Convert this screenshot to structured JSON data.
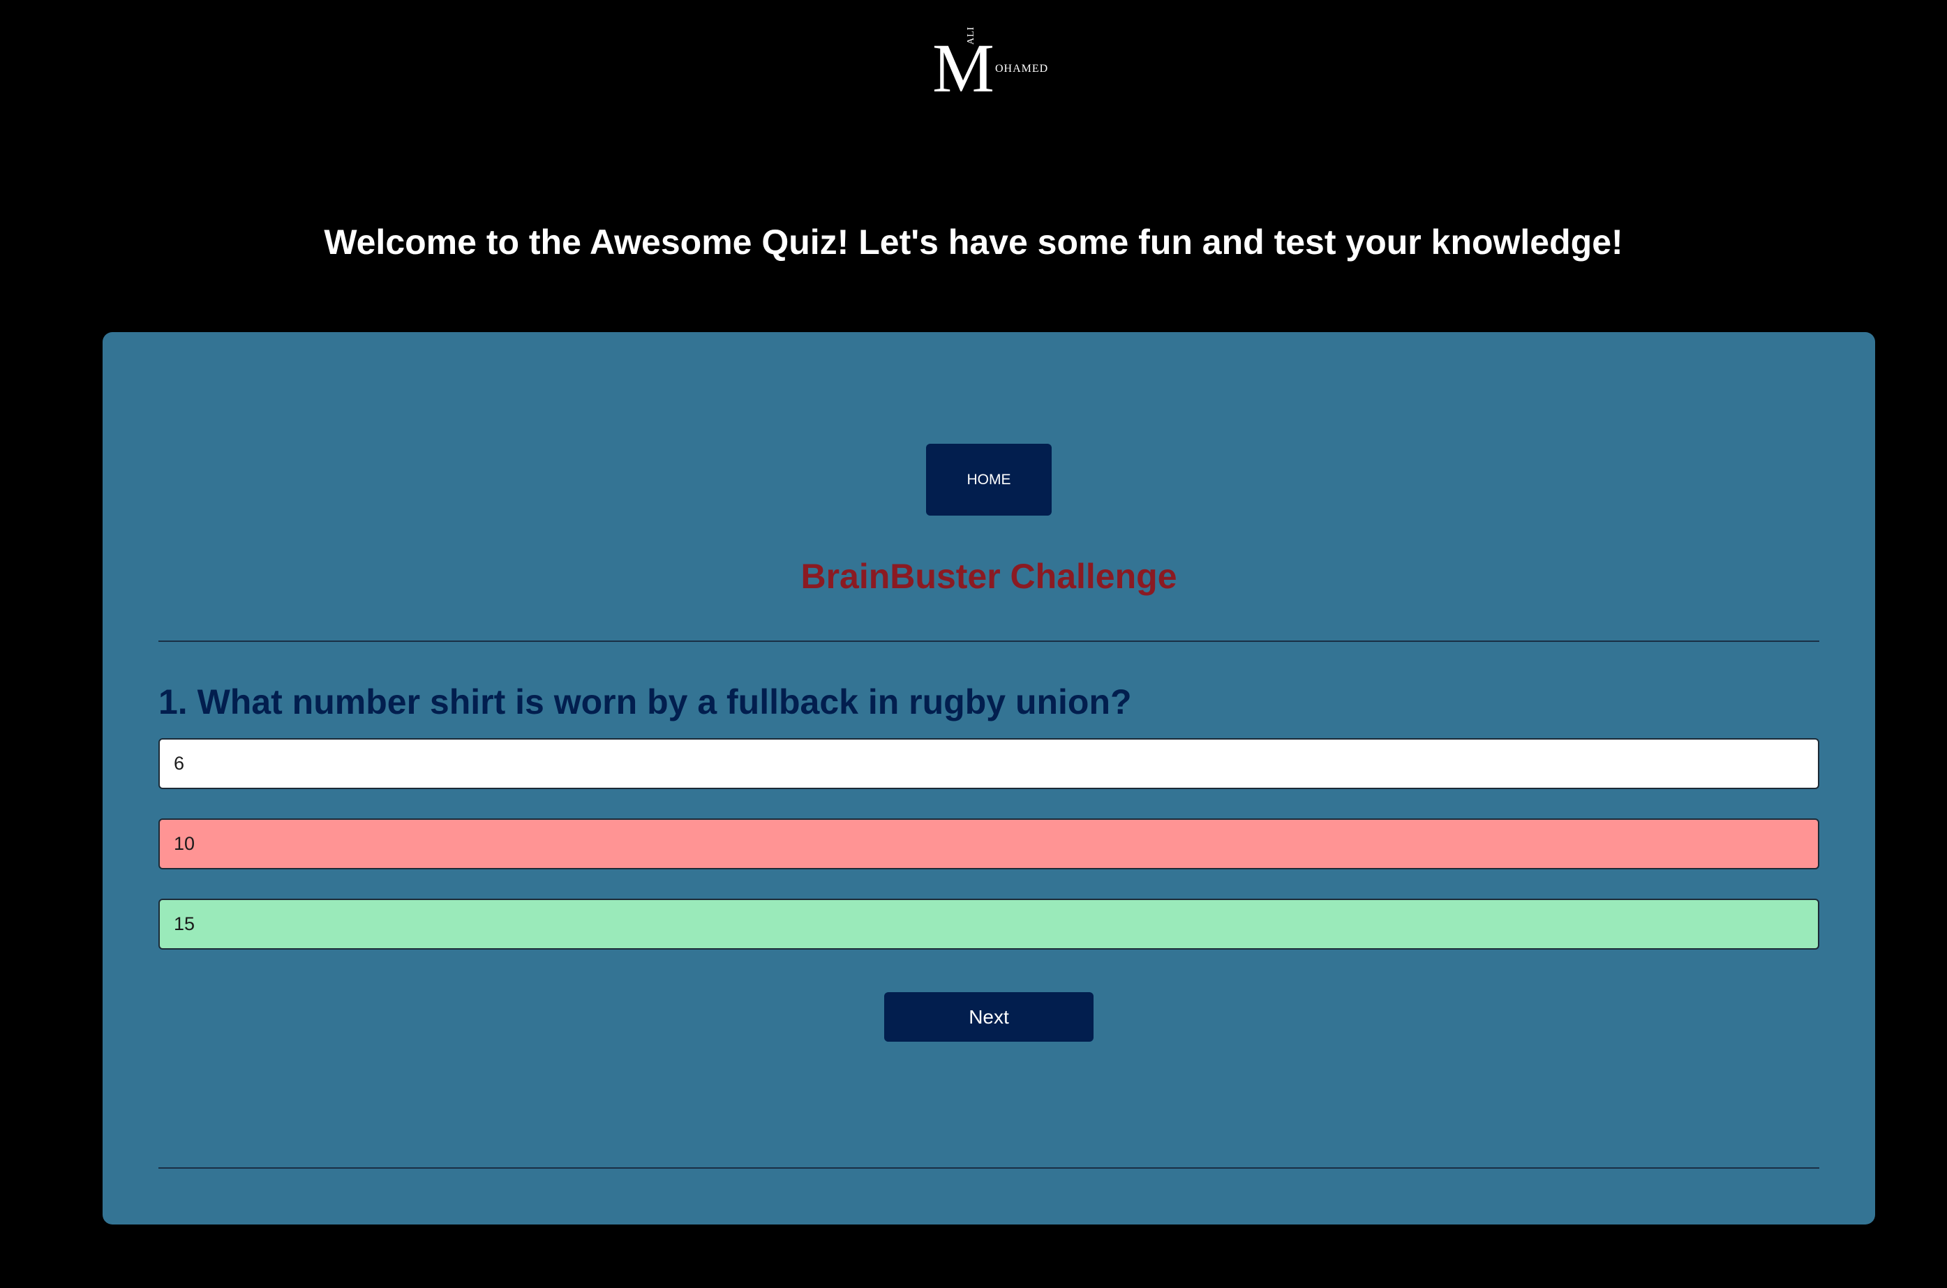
{
  "logo": {
    "big_letter": "M",
    "side_text_vertical": "ALI",
    "side_text": "OHAMED"
  },
  "header": {
    "welcome": "Welcome to the Awesome Quiz! Let's have some fun and test your knowledge!"
  },
  "panel": {
    "home_label": "HOME",
    "title": "BrainBuster Challenge",
    "question": "1. What number shirt is worn by a fullback in rugby union?",
    "answers": [
      {
        "label": "6",
        "state": "neutral",
        "color": "#ffffff"
      },
      {
        "label": "10",
        "state": "incorrect",
        "color": "#ff9494"
      },
      {
        "label": "15",
        "state": "correct",
        "color": "#9aeaba"
      }
    ],
    "next_label": "Next"
  },
  "colors": {
    "page_background": "#000000",
    "panel_background": "#347494",
    "button_background": "#021e4e",
    "title_color": "#8b1a22",
    "question_color": "#021e4e"
  }
}
